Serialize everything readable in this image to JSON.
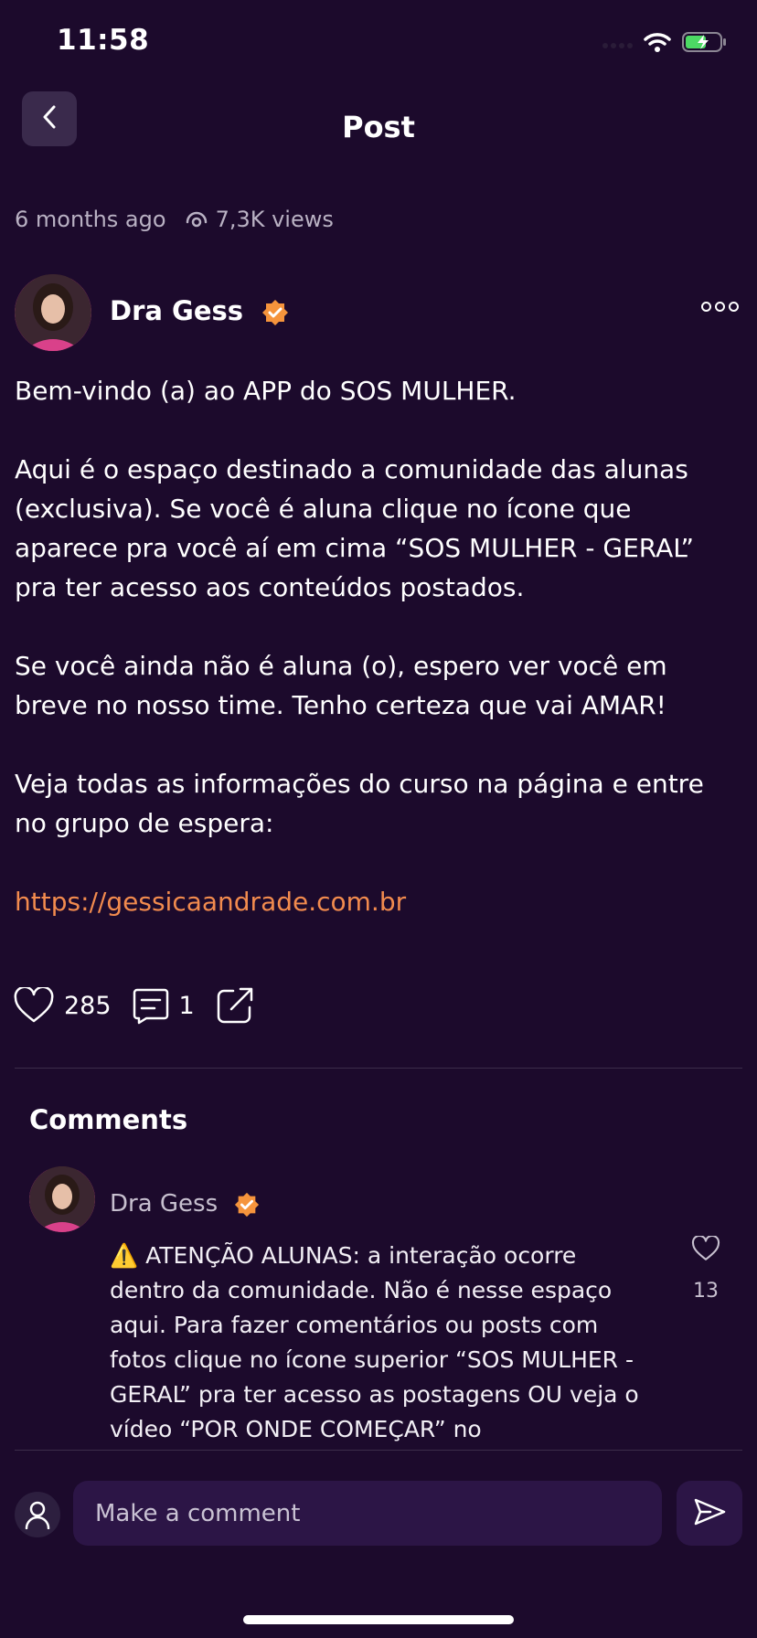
{
  "status_bar": {
    "time": "11:58",
    "icons": [
      "signal-icon",
      "wifi-icon",
      "battery-charging-icon"
    ]
  },
  "header": {
    "title": "Post",
    "back_icon": "chevron-left-icon"
  },
  "post": {
    "time_ago": "6 months ago",
    "views": "7,3K views",
    "author": "Dra Gess",
    "paragraphs": [
      "Bem-vindo (a) ao APP do SOS MULHER.",
      "Aqui é o espaço destinado a comunidade das alunas (exclusiva). Se você é aluna clique no ícone que aparece pra você aí em cima “SOS MULHER - GERAL” pra ter acesso aos conteúdos postados.",
      "Se você ainda não é aluna (o), espero ver você em breve no nosso time. Tenho certeza que vai AMAR!",
      "Veja todas as informações do curso na página e entre no grupo de espera:"
    ],
    "link": "https://gessicaandrade.com.br",
    "likes": "285",
    "comments_count": "1"
  },
  "comments": {
    "title": "Comments",
    "items": [
      {
        "author": "Dra Gess",
        "text": "⚠️ ATENÇÃO ALUNAS: a interação ocorre dentro da comunidade. Não é nesse espaço aqui. Para fazer comentários ou posts com fotos clique no ícone superior “SOS MULHER - GERAL” pra ter acesso as postagens OU veja o vídeo “POR ONDE COMEÇAR” no",
        "likes": "13"
      }
    ]
  },
  "composer": {
    "placeholder": "Make a comment"
  },
  "colors": {
    "background": "#1c0a2c",
    "accent": "#f28b4e",
    "verified": "#f5943c",
    "input_bg": "#2c1546"
  }
}
